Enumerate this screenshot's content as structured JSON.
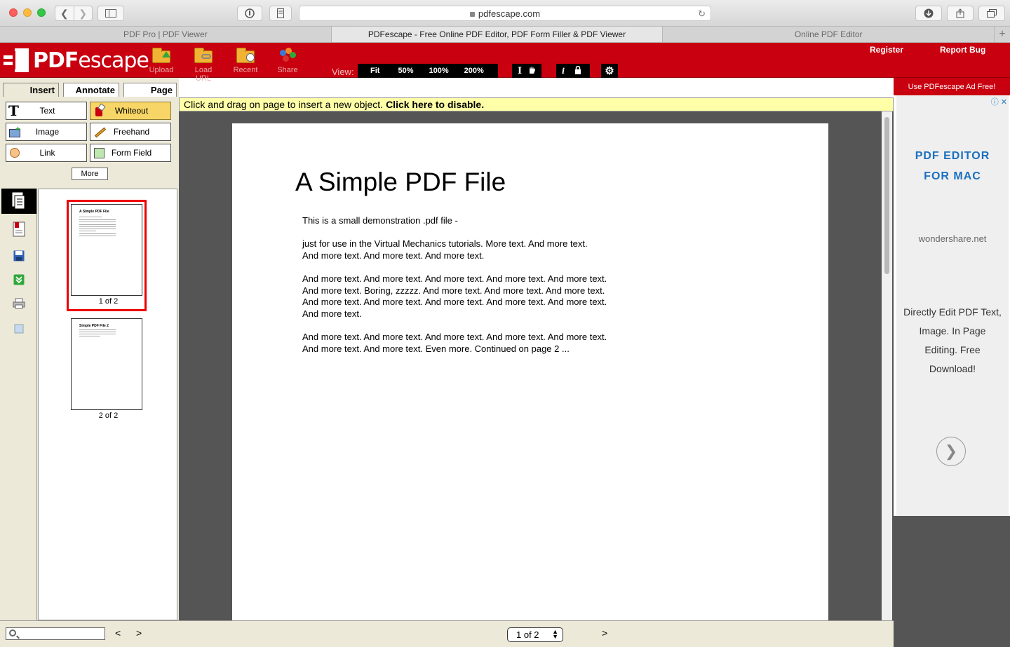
{
  "browser": {
    "url": "pdfescape.com",
    "tabs": [
      {
        "label": "PDF Pro | PDF Viewer"
      },
      {
        "label": "PDFescape - Free Online PDF Editor, PDF Form Filler & PDF Viewer"
      },
      {
        "label": "Online PDF Editor"
      }
    ]
  },
  "header": {
    "logo_pdf": "PDF",
    "logo_escape": "escape",
    "tools": [
      {
        "label": "Upload",
        "icon": "upload-folder-icon"
      },
      {
        "label": "Load URL",
        "icon": "load-url-folder-icon"
      },
      {
        "label": "Recent",
        "icon": "recent-folder-icon"
      },
      {
        "label": "Share",
        "icon": "share-people-icon"
      }
    ],
    "view_label": "View:",
    "view_options": [
      "Fit",
      "50%",
      "100%",
      "200%"
    ],
    "register": "Register",
    "report_bug": "Report Bug"
  },
  "left": {
    "tabs": [
      "Insert",
      "Annotate",
      "Page"
    ],
    "tools": [
      {
        "label": "Text",
        "icon": "text-tool-icon"
      },
      {
        "label": "Whiteout",
        "icon": "whiteout-icon"
      },
      {
        "label": "Image",
        "icon": "image-tool-icon"
      },
      {
        "label": "Freehand",
        "icon": "pencil-icon"
      },
      {
        "label": "Link",
        "icon": "link-tool-icon"
      },
      {
        "label": "Form Field",
        "icon": "form-field-icon"
      }
    ],
    "more": "More",
    "thumbs": [
      {
        "label": "1 of 2",
        "title": "A Simple PDF File"
      },
      {
        "label": "2 of 2",
        "title": "Simple PDF File 2"
      }
    ]
  },
  "notice": {
    "text": "Click and drag on page to insert a new object.",
    "link": "Click here to disable."
  },
  "document": {
    "title": "A Simple PDF File",
    "paragraphs": [
      "This is a small demonstration .pdf file -",
      "just for use in the Virtual Mechanics tutorials. More text. And more text. And more text. And more text. And more text.",
      "And more text. And more text. And more text. And more text. And more text. And more text. Boring, zzzzz. And more text. And more text. And more text. And more text. And more text. And more text. And more text. And more text. And more text.",
      "And more text. And more text. And more text. And more text. And more text. And more text. And more text. Even more. Continued on page 2 ..."
    ]
  },
  "ad": {
    "top": "Use PDFescape Ad Free!",
    "headline_1": "PDF EDITOR",
    "headline_2": "FOR MAC",
    "domain": "wondershare.net",
    "body": "Directly Edit PDF Text, Image. In Page Editing. Free Download!"
  },
  "bottom": {
    "prev": "<",
    "next": ">",
    "page_select": "1 of 2",
    "next_page": ">"
  },
  "colors": {
    "brand_red": "#c8000f",
    "whiteout_yellow": "#f7d566",
    "notice_yellow": "#ffffa8",
    "ad_blue": "#1a6fc0"
  }
}
